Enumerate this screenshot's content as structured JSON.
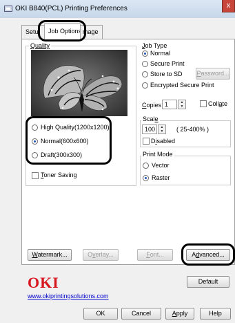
{
  "window": {
    "title": "OKI B840(PCL) Printing Preferences",
    "close_glyph": "x"
  },
  "tabs": [
    {
      "label": "Setup",
      "visible": "Setu"
    },
    {
      "label": "Job Options"
    },
    {
      "label": "Image",
      "visible": "mage"
    }
  ],
  "quality": {
    "label": "Quality",
    "image_icon": "monarch-butterfly-preview",
    "options": [
      {
        "label": "High Quality(1200x1200)",
        "selected": false
      },
      {
        "label": "Normal(600x600)",
        "selected": true
      },
      {
        "label": "Draft(300x300)",
        "selected": false
      }
    ],
    "toner_saving": {
      "label": "Toner Saving",
      "checked": false
    }
  },
  "job_type": {
    "label": "Job Type",
    "options": [
      {
        "label": "Normal",
        "selected": true
      },
      {
        "label": "Secure Print",
        "selected": false
      },
      {
        "label": "Store to SD",
        "selected": false
      },
      {
        "label": "Encrypted Secure Print",
        "selected": false
      }
    ],
    "password_button": "Password..."
  },
  "copies": {
    "label": "Copies",
    "value": "1",
    "collate_label": "Collate",
    "collate_checked": false
  },
  "scale": {
    "label": "Scale",
    "value": "100",
    "range": "( 25-400% )",
    "disabled_label": "Disabled",
    "disabled_checked": false
  },
  "print_mode": {
    "label": "Print Mode",
    "options": [
      {
        "label": "Vector",
        "selected": false
      },
      {
        "label": "Raster",
        "selected": true
      }
    ]
  },
  "buttons": {
    "watermark": "Watermark...",
    "overlay": "Overlay...",
    "font": "Font...",
    "advanced": "Advanced...",
    "default": "Default"
  },
  "brand": {
    "logo": "OKI",
    "link": "www.okiprintingsolutions.com",
    "color": "#d7171f"
  },
  "footer": {
    "ok": "OK",
    "cancel": "Cancel",
    "apply": "Apply",
    "help": "Help"
  },
  "colors": {
    "selected_radio": "#1f57b4",
    "link": "#0000cc",
    "close": "#c8453b"
  }
}
